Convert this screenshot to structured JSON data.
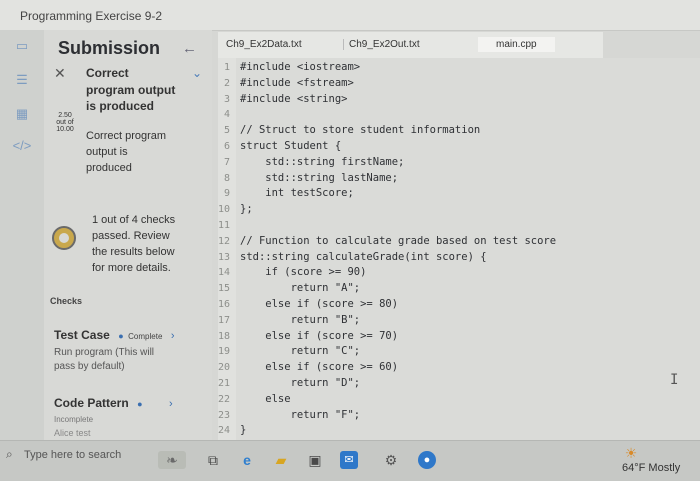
{
  "window": {
    "title": "Programming Exercise 9-2"
  },
  "panel": {
    "title": "Submission",
    "status": "Correct",
    "score_value": "2.50",
    "score_mid": "out of",
    "score_total": "10.00",
    "headline_1": "program output",
    "headline_2": "is produced",
    "detail_1": "Correct program",
    "detail_2": "output is",
    "detail_3": "produced",
    "summary_1": "1 out of 4 checks",
    "summary_2": "passed. Review",
    "summary_3": "the results below",
    "summary_4": "for more details.",
    "checks_label": "Checks",
    "test_case": {
      "label": "Test Case",
      "status": "Complete",
      "desc_1": "Run program (This will",
      "desc_2": "pass by default)"
    },
    "code_pattern": {
      "label": "Code Pattern",
      "status": "Incomplete",
      "next": "Alice test"
    }
  },
  "tabs": [
    "Ch9_Ex2Data.txt",
    "Ch9_Ex2Out.txt",
    "main.cpp"
  ],
  "code_lines": [
    "#include <iostream>",
    "#include <fstream>",
    "#include <string>",
    "",
    "// Struct to store student information",
    "struct Student {",
    "    std::string firstName;",
    "    std::string lastName;",
    "    int testScore;",
    "};",
    "",
    "// Function to calculate grade based on test score",
    "std::string calculateGrade(int score) {",
    "    if (score >= 90)",
    "        return \"A\";",
    "    else if (score >= 80)",
    "        return \"B\";",
    "    else if (score >= 70)",
    "        return \"C\";",
    "    else if (score >= 60)",
    "        return \"D\";",
    "    else",
    "        return \"F\";",
    "}"
  ],
  "line_numbers": [
    "1",
    "2",
    "3",
    "4",
    "5",
    "6",
    "7",
    "8",
    "9",
    "10",
    "11",
    "12",
    "13",
    "14",
    "15",
    "16",
    "17",
    "18",
    "19",
    "20",
    "21",
    "22",
    "23",
    "24"
  ],
  "taskbar": {
    "search_placeholder": "Type here to search",
    "weather": "64°F  Mostly"
  },
  "icons": [
    "submission-icon",
    "list-icon",
    "grid-icon",
    "code-icon",
    "search-icon",
    "explorer-icon",
    "edge-icon",
    "store-icon",
    "mail-icon",
    "settings-icon",
    "weather-icon"
  ],
  "colors": {
    "accent": "#3b6fb0",
    "gauge": "#c9a84c"
  }
}
